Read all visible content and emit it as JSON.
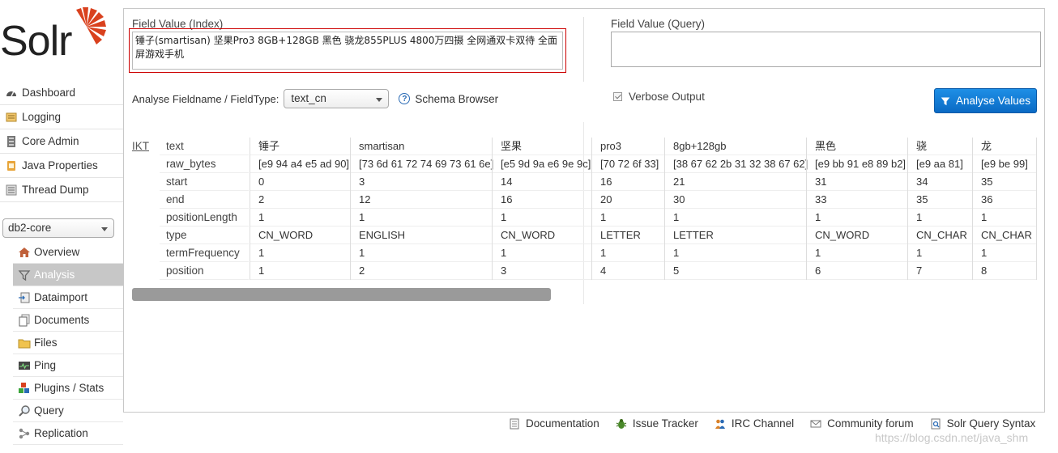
{
  "app": {
    "logo_text": "Solr"
  },
  "sidebar": {
    "items": [
      {
        "label": "Dashboard",
        "icon": "dashboard-icon"
      },
      {
        "label": "Logging",
        "icon": "logging-icon"
      },
      {
        "label": "Core Admin",
        "icon": "core-admin-icon"
      },
      {
        "label": "Java Properties",
        "icon": "java-icon"
      },
      {
        "label": "Thread Dump",
        "icon": "thread-dump-icon"
      }
    ],
    "core_selector": {
      "value": "db2-core"
    },
    "core_items": [
      {
        "label": "Overview",
        "icon": "home-icon"
      },
      {
        "label": "Analysis",
        "icon": "funnel-icon",
        "active": true
      },
      {
        "label": "Dataimport",
        "icon": "dataimport-icon"
      },
      {
        "label": "Documents",
        "icon": "documents-icon"
      },
      {
        "label": "Files",
        "icon": "folder-icon"
      },
      {
        "label": "Ping",
        "icon": "ping-icon"
      },
      {
        "label": "Plugins / Stats",
        "icon": "plugins-icon"
      },
      {
        "label": "Query",
        "icon": "query-icon"
      },
      {
        "label": "Replication",
        "icon": "replication-icon"
      }
    ]
  },
  "main": {
    "index_label": "Field Value (Index)",
    "index_value": "锤子(smartisan) 坚果Pro3 8GB+128GB 黑色 骁龙855PLUS 4800万四摄 全网通双卡双待 全面屏游戏手机",
    "query_label": "Field Value (Query)",
    "query_value": "",
    "fieldtype_label": "Analyse Fieldname / FieldType:",
    "fieldtype_value": "text_cn",
    "schema_browser": "Schema Browser",
    "verbose_label": "Verbose Output",
    "verbose_checked": true,
    "analyse_button": "Analyse Values",
    "accent_color": "#0f7bd6"
  },
  "analysis": {
    "tokenizer": "IKT",
    "attributes": [
      "text",
      "raw_bytes",
      "start",
      "end",
      "positionLength",
      "type",
      "termFrequency",
      "position"
    ],
    "tokens": [
      [
        "锤子",
        "[e9 94 a4 e5 ad 90]",
        "0",
        "2",
        "1",
        "CN_WORD",
        "1",
        "1"
      ],
      [
        "smartisan",
        "[73 6d 61 72 74 69 73 61 6e]",
        "3",
        "12",
        "1",
        "ENGLISH",
        "1",
        "2"
      ],
      [
        "坚果",
        "[e5 9d 9a e6 9e 9c]",
        "14",
        "16",
        "1",
        "CN_WORD",
        "1",
        "3"
      ],
      [
        "pro3",
        "[70 72 6f 33]",
        "16",
        "20",
        "1",
        "LETTER",
        "1",
        "4"
      ],
      [
        "8gb+128gb",
        "[38 67 62 2b 31 32 38 67 62]",
        "21",
        "30",
        "1",
        "LETTER",
        "1",
        "5"
      ],
      [
        "黑色",
        "[e9 bb 91 e8 89 b2]",
        "31",
        "33",
        "1",
        "CN_WORD",
        "1",
        "6"
      ],
      [
        "骁",
        "[e9 aa 81]",
        "34",
        "35",
        "1",
        "CN_CHAR",
        "1",
        "7"
      ],
      [
        "龙",
        "[e9 be 99]",
        "35",
        "36",
        "1",
        "CN_CHAR",
        "1",
        "8"
      ]
    ]
  },
  "footer": {
    "links": [
      {
        "label": "Documentation",
        "icon": "documentation-icon"
      },
      {
        "label": "Issue Tracker",
        "icon": "bug-icon"
      },
      {
        "label": "IRC Channel",
        "icon": "irc-icon"
      },
      {
        "label": "Community forum",
        "icon": "mail-icon"
      },
      {
        "label": "Solr Query Syntax",
        "icon": "syntax-icon"
      }
    ],
    "watermark": "https://blog.csdn.net/java_shm"
  }
}
